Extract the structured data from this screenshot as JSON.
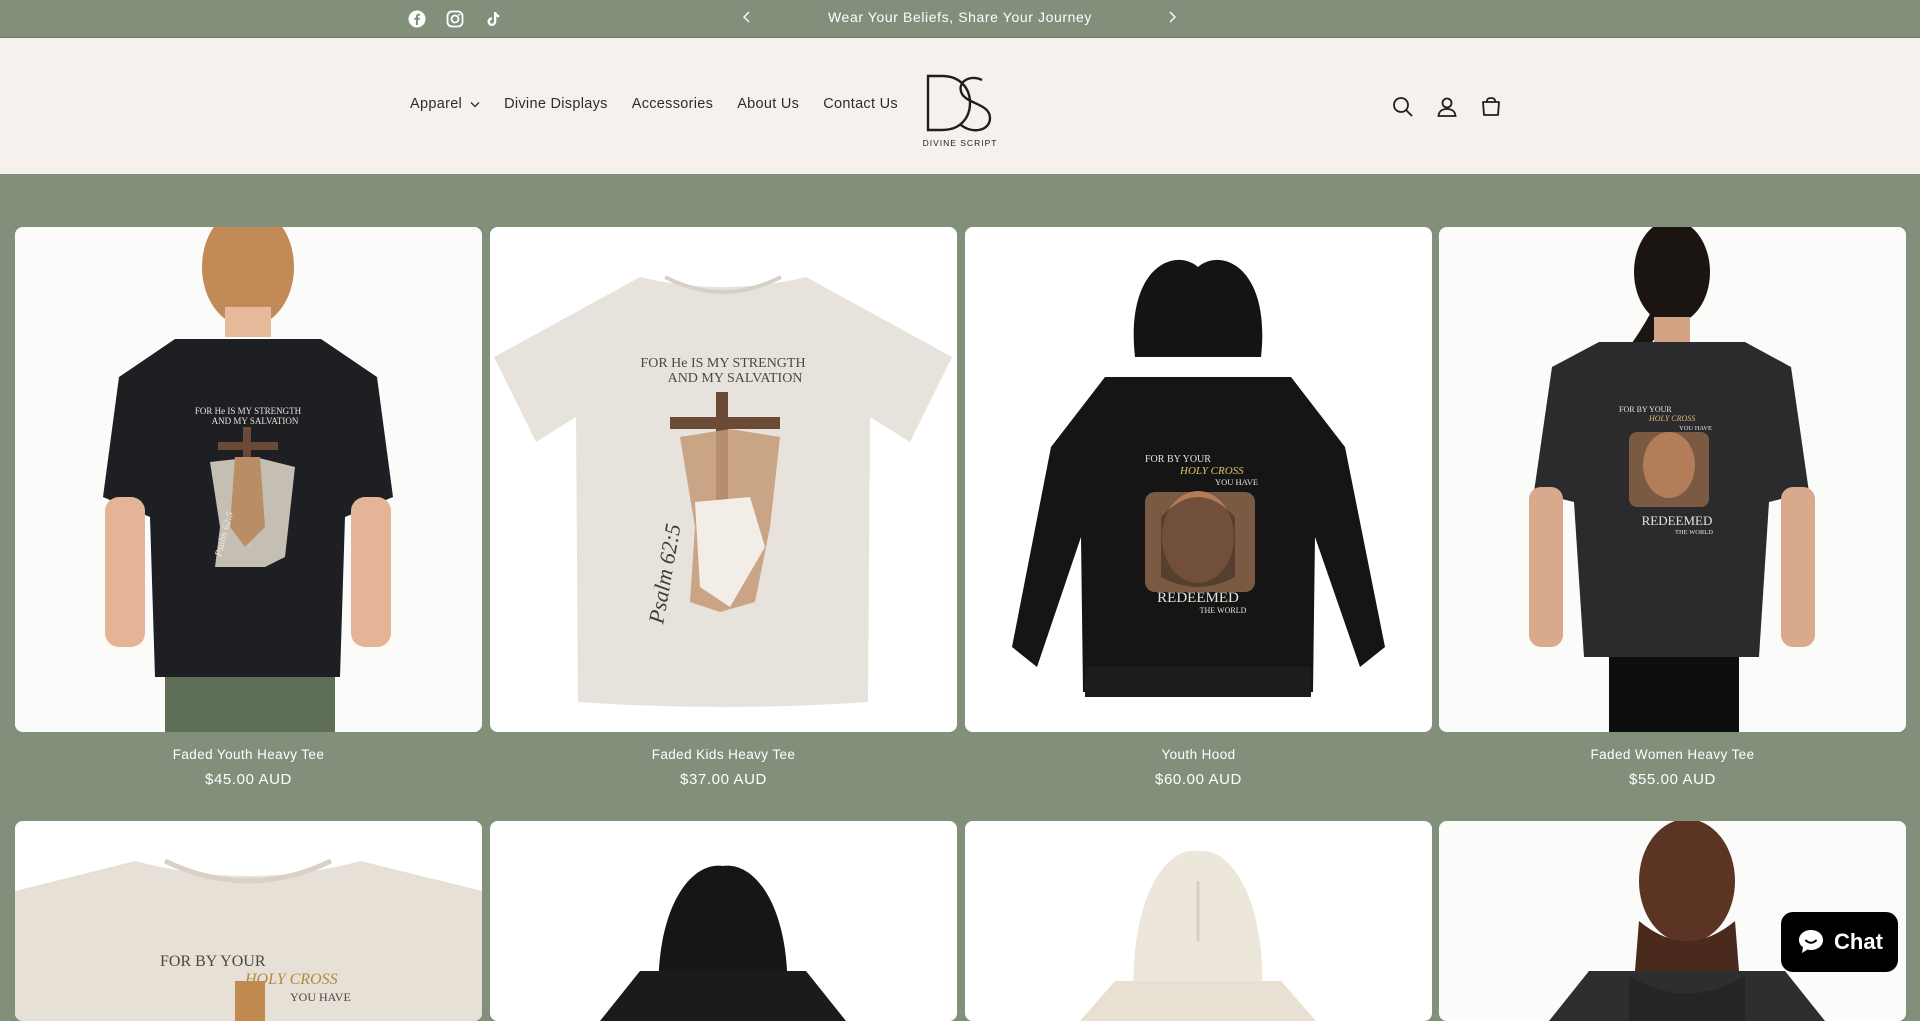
{
  "announcement": {
    "message": "Wear Your Beliefs, Share Your Journey",
    "prev_icon": "chevron-left-icon",
    "next_icon": "chevron-right-icon"
  },
  "social": [
    {
      "name": "facebook-icon"
    },
    {
      "name": "instagram-icon"
    },
    {
      "name": "tiktok-icon"
    }
  ],
  "nav": {
    "items": [
      {
        "label": "Apparel",
        "has_dropdown": true
      },
      {
        "label": "Divine Displays"
      },
      {
        "label": "Accessories"
      },
      {
        "label": "About Us"
      },
      {
        "label": "Contact Us"
      }
    ]
  },
  "logo": {
    "monogram": "DS",
    "text": "DIVINE SCRIPT"
  },
  "header_icons": [
    "search-icon",
    "account-icon",
    "cart-icon"
  ],
  "products": [
    {
      "title": "Faded Youth Heavy Tee",
      "price": "$45.00 AUD"
    },
    {
      "title": "Faded Kids Heavy Tee",
      "price": "$37.00 AUD"
    },
    {
      "title": "Youth Hood",
      "price": "$60.00 AUD"
    },
    {
      "title": "Faded Women Heavy Tee",
      "price": "$55.00 AUD"
    }
  ],
  "product_prints": {
    "strength": [
      "FOR He IS MY STRENGTH",
      "AND MY SALVATION"
    ],
    "psalm": "Psalm 62:5",
    "cross": [
      "FOR BY YOUR",
      "HOLY CROSS",
      "YOU HAVE",
      "REDEEMED",
      "THE WORLD"
    ]
  },
  "chat": {
    "label": "Chat"
  },
  "colors": {
    "page_bg": "#828f7b",
    "header_bg": "#f5f2ed",
    "text_light": "#ffffff"
  }
}
